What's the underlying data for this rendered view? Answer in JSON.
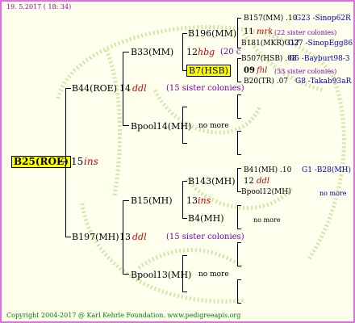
{
  "header": {
    "date": "19.  5.2017  ( 18: 34)"
  },
  "footer": {
    "copyright": "Copyright 2004-2017 @ Karl Kehrle Foundation.   www.pedigreeapis.org"
  },
  "root": {
    "name": "B25(ROE)",
    "num": "15",
    "tag": "ins"
  },
  "gen1": {
    "a": {
      "name": "B44(ROE)",
      "num": "14",
      "tag": "ddl",
      "note": "(15 sister colonies)"
    },
    "b": {
      "name": "B197(MH)",
      "num": "13",
      "tag": "ddl",
      "note": "(15 sister colonies)"
    }
  },
  "gen2": {
    "a": {
      "name": "B33(MM)"
    },
    "b": {
      "name": "Bpool14(MH)",
      "note": "no more"
    },
    "c": {
      "name": "B15(MH)",
      "num": "13",
      "tag": "ins"
    },
    "d": {
      "name": "Bpool13(MH)",
      "note": "no more"
    }
  },
  "gen3": {
    "a": {
      "name": "B196(MM)"
    },
    "a_num": "12",
    "a_tag": "hbg",
    "a_note": "(20 c",
    "b": {
      "name": "B7(HSB)"
    },
    "c": {
      "name": "B143(MH)"
    },
    "d": {
      "name": "B4(MH)",
      "note": "no more"
    }
  },
  "gen4": {
    "r1": "B157(MM) .10",
    "r1b": "G23 -Sinop62R",
    "r2_num": "11",
    "r2_tag": "mrk",
    "r2_note": "(22 sister colonies)",
    "r3": "B181(MKR)G17",
    "r3b": "G27 -SinopEgg86R",
    "r4": "B507(HSB) .08",
    "r4b": "G5 -Bayburt98-3",
    "r5_num": "09",
    "r5_tag": "fhl",
    "r5_note": "(33 sister colonies)",
    "r6": "B20(TR) .07",
    "r6b": "G8 -Takab93aR",
    "r7": "B41(MH) .10",
    "r7b": "G1 -B28(MH)",
    "r8_num": "12",
    "r8_tag": "ddl",
    "r9": "Bpool12(MH)",
    "r9b": "no more"
  }
}
